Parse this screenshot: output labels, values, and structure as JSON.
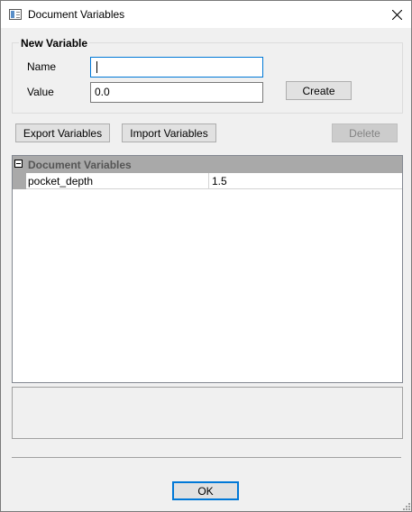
{
  "window": {
    "title": "Document Variables",
    "icon": "window-icon",
    "close_icon": "close-icon"
  },
  "new_variable": {
    "group_title": "New Variable",
    "name_label": "Name",
    "name_value": "",
    "value_label": "Value",
    "value_value": "0.0",
    "create_label": "Create"
  },
  "toolbar": {
    "export_label": "Export Variables",
    "import_label": "Import Variables",
    "delete_label": "Delete"
  },
  "grid": {
    "category": "Document Variables",
    "rows": [
      {
        "name": "pocket_depth",
        "value": "1.5"
      }
    ]
  },
  "footer": {
    "ok_label": "OK"
  }
}
